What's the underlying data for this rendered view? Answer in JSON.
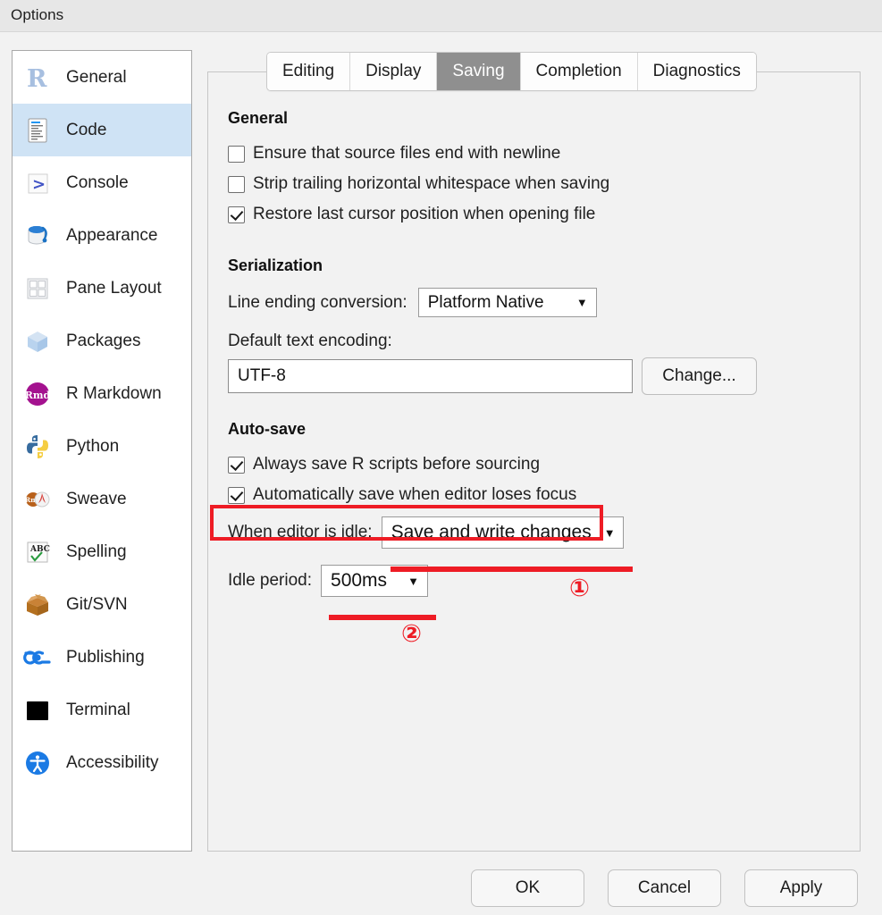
{
  "window": {
    "title": "Options"
  },
  "sidebar": {
    "items": [
      {
        "label": "General",
        "icon": "r-logo-icon",
        "selected": false
      },
      {
        "label": "Code",
        "icon": "code-file-icon",
        "selected": true
      },
      {
        "label": "Console",
        "icon": "console-prompt-icon",
        "selected": false
      },
      {
        "label": "Appearance",
        "icon": "paint-bucket-icon",
        "selected": false
      },
      {
        "label": "Pane Layout",
        "icon": "pane-grid-icon",
        "selected": false
      },
      {
        "label": "Packages",
        "icon": "package-box-icon",
        "selected": false
      },
      {
        "label": "R Markdown",
        "icon": "rmd-badge-icon",
        "selected": false
      },
      {
        "label": "Python",
        "icon": "python-logo-icon",
        "selected": false
      },
      {
        "label": "Sweave",
        "icon": "sweave-pdf-icon",
        "selected": false
      },
      {
        "label": "Spelling",
        "icon": "abc-check-icon",
        "selected": false
      },
      {
        "label": "Git/SVN",
        "icon": "open-box-icon",
        "selected": false
      },
      {
        "label": "Publishing",
        "icon": "publish-icon",
        "selected": false
      },
      {
        "label": "Terminal",
        "icon": "terminal-icon",
        "selected": false
      },
      {
        "label": "Accessibility",
        "icon": "accessibility-icon",
        "selected": false
      }
    ]
  },
  "tabs": [
    {
      "label": "Editing",
      "active": false
    },
    {
      "label": "Display",
      "active": false
    },
    {
      "label": "Saving",
      "active": true
    },
    {
      "label": "Completion",
      "active": false
    },
    {
      "label": "Diagnostics",
      "active": false
    }
  ],
  "sections": {
    "general": {
      "heading": "General",
      "checkboxes": [
        {
          "label": "Ensure that source files end with newline",
          "checked": false
        },
        {
          "label": "Strip trailing horizontal whitespace when saving",
          "checked": false
        },
        {
          "label": "Restore last cursor position when opening file",
          "checked": true
        }
      ]
    },
    "serialization": {
      "heading": "Serialization",
      "line_ending_label": "Line ending conversion:",
      "line_ending_value": "Platform Native",
      "encoding_label": "Default text encoding:",
      "encoding_value": "UTF-8",
      "change_button": "Change..."
    },
    "autosave": {
      "heading": "Auto-save",
      "checkboxes": [
        {
          "label": "Always save R scripts before sourcing",
          "checked": true
        },
        {
          "label": "Automatically save when editor loses focus",
          "checked": true
        }
      ],
      "idle_action_label": "When editor is idle:",
      "idle_action_value": "Save and write changes",
      "idle_period_label": "Idle period:",
      "idle_period_value": "500ms"
    }
  },
  "annotations": {
    "color": "#ee1c25",
    "marker_one": "①",
    "marker_two": "②"
  },
  "footer": {
    "ok": "OK",
    "cancel": "Cancel",
    "apply": "Apply"
  },
  "caret_glyph": "▼"
}
